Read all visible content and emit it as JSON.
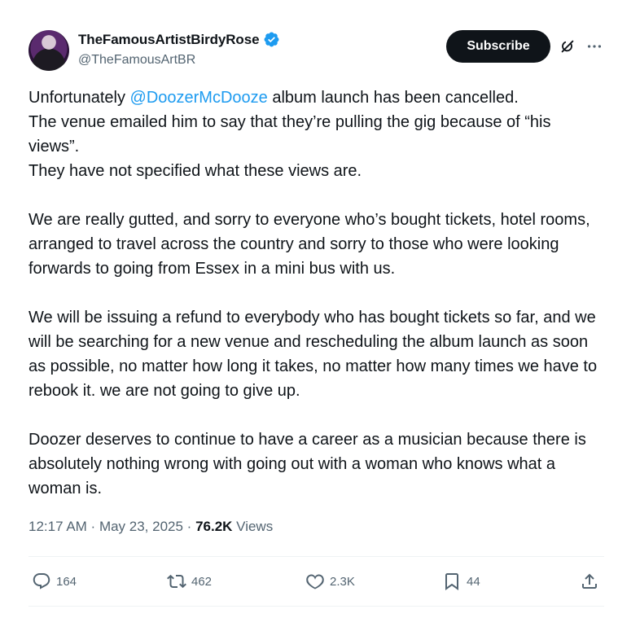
{
  "author": {
    "display_name": "TheFamousArtistBirdyRose",
    "handle": "@TheFamousArtBR",
    "verified": true,
    "avatar_icon": "avatar-photo"
  },
  "header": {
    "subscribe_label": "Subscribe",
    "grok_icon": "grok-icon",
    "more_icon": "more-horizontal-icon"
  },
  "post": {
    "p1_before": "Unfortunately ",
    "p1_mention": "@DoozerMcDooze",
    "p1_after": " album launch has been cancelled.",
    "p2": "The venue emailed him to say that they’re pulling the gig because of “his views”.",
    "p3": "They have not specified what these views are.",
    "p4": "We are really gutted, and sorry to everyone who’s bought tickets, hotel rooms, arranged to travel across the country and sorry to those who were looking forwards to going from Essex in a mini bus with us.",
    "p5": "We will be issuing a refund to everybody who has bought tickets so far, and we will be searching for a new venue and rescheduling the album launch as soon as possible, no matter how long it takes, no matter how many times we have to rebook it. we are not going to give up.",
    "p6": "Doozer deserves to continue to have a career as a musician because there is absolutely nothing wrong with going out with a woman who knows what a woman is."
  },
  "meta": {
    "time": "12:17 AM",
    "separator": " · ",
    "date": "May 23, 2025",
    "views_count": "76.2K",
    "views_label": " Views"
  },
  "actions": {
    "replies": "164",
    "reposts": "462",
    "likes": "2.3K",
    "bookmarks": "44"
  },
  "colors": {
    "accent": "#1d9bf0",
    "text": "#0f1419",
    "muted": "#536471"
  }
}
